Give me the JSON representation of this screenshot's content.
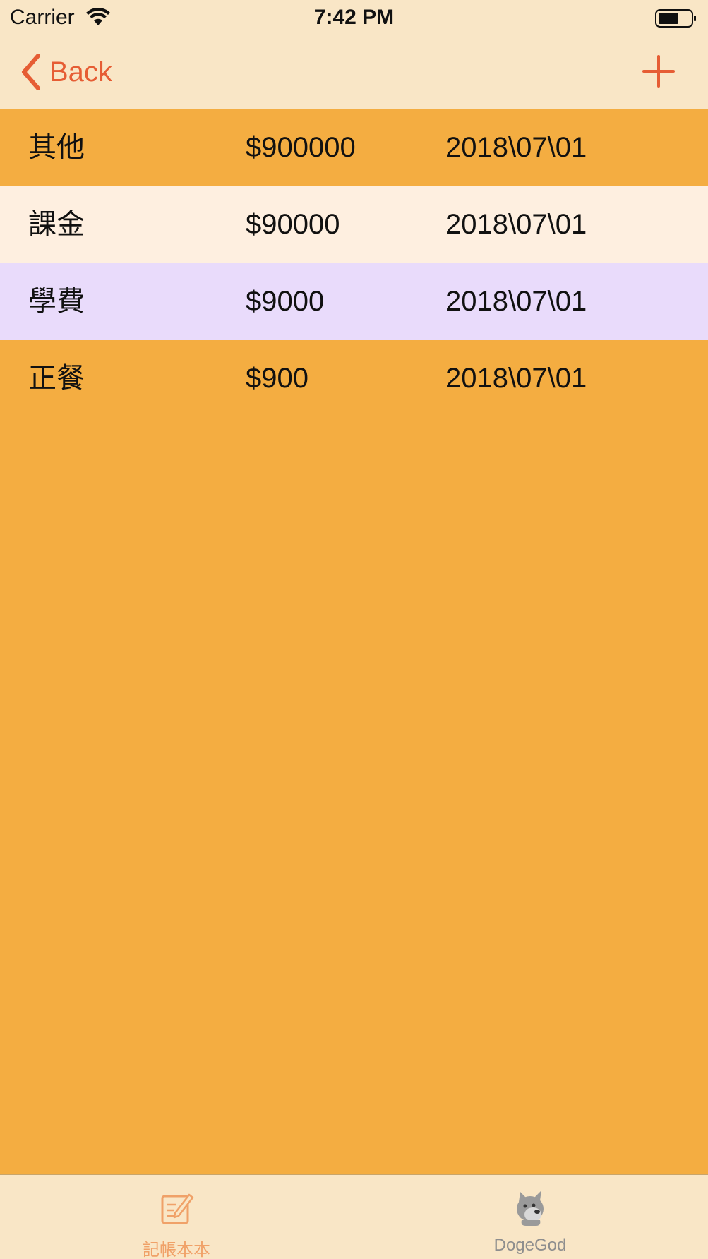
{
  "status_bar": {
    "carrier": "Carrier",
    "time": "7:42 PM"
  },
  "nav": {
    "back_label": "Back",
    "accent_color": "#e65d34"
  },
  "records": [
    {
      "name": "其他",
      "amount": "$900000",
      "date": "2018\\07\\01",
      "row_color": "#f4ad41"
    },
    {
      "name": "課金",
      "amount": "$90000",
      "date": "2018\\07\\01",
      "row_color": "#feefe0"
    },
    {
      "name": "學費",
      "amount": "$9000",
      "date": "2018\\07\\01",
      "row_color": "#e9dbfb"
    },
    {
      "name": "正餐",
      "amount": "$900",
      "date": "2018\\07\\01",
      "row_color": "#f4ad41"
    }
  ],
  "tab_bar": {
    "tabs": [
      {
        "label": "記帳本本",
        "icon": "edit-note-icon",
        "selected": true,
        "color": "#f0a168"
      },
      {
        "label": "DogeGod",
        "icon": "doge-icon",
        "selected": false,
        "color": "#8e8e8e"
      }
    ]
  },
  "colors": {
    "background": "#f4ad41",
    "bar_background": "#f9e6c6"
  }
}
